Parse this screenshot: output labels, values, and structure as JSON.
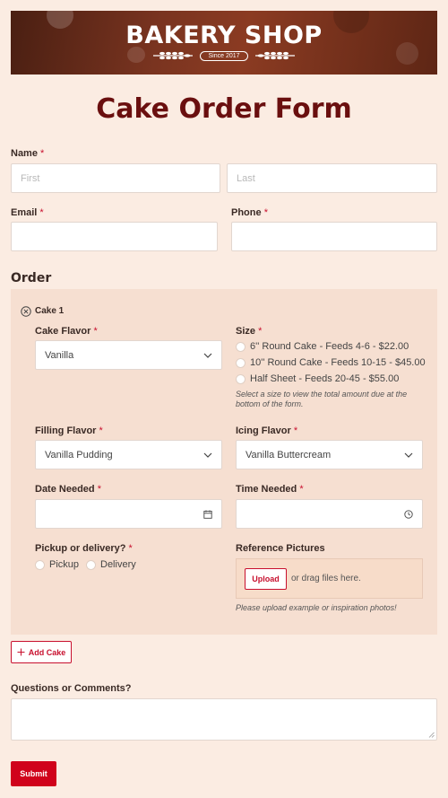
{
  "banner": {
    "title": "BAKERY SHOP",
    "since": "Since 2017"
  },
  "page_title": "Cake Order Form",
  "name": {
    "label": "Name",
    "required": "*",
    "first_placeholder": "First",
    "last_placeholder": "Last"
  },
  "email": {
    "label": "Email",
    "required": "*"
  },
  "phone": {
    "label": "Phone",
    "required": "*"
  },
  "order": {
    "section_title": "Order",
    "cake_title": "Cake 1",
    "cake_flavor": {
      "label": "Cake Flavor",
      "required": "*",
      "value": "Vanilla"
    },
    "size": {
      "label": "Size",
      "required": "*",
      "options": [
        "6'' Round Cake - Feeds 4-6 - $22.00",
        "10'' Round Cake - Feeds 10-15 - $45.00",
        "Half Sheet - Feeds 20-45 - $55.00"
      ],
      "hint_line1": "Select a size to view the total amount due at the",
      "hint_line2": "bottom of the form."
    },
    "filling_flavor": {
      "label": "Filling Flavor",
      "required": "*",
      "value": "Vanilla Pudding"
    },
    "icing_flavor": {
      "label": "Icing Flavor",
      "required": "*",
      "value": "Vanilla Buttercream"
    },
    "date_needed": {
      "label": "Date Needed",
      "required": "*"
    },
    "time_needed": {
      "label": "Time Needed",
      "required": "*"
    },
    "pickup": {
      "label": "Pickup or delivery?",
      "required": "*",
      "options": [
        "Pickup",
        "Delivery"
      ]
    },
    "reference": {
      "label": "Reference Pictures",
      "upload_label": "Upload",
      "drag_text": "or drag files here.",
      "hint": "Please upload example or inspiration photos!"
    }
  },
  "add_cake_label": "Add Cake",
  "comments": {
    "label": "Questions or Comments?"
  },
  "submit_label": "Submit",
  "colors": {
    "accent": "#c8102e",
    "title": "#6a0f0f",
    "background": "#fbece2",
    "order_box": "#f6dfd1"
  }
}
